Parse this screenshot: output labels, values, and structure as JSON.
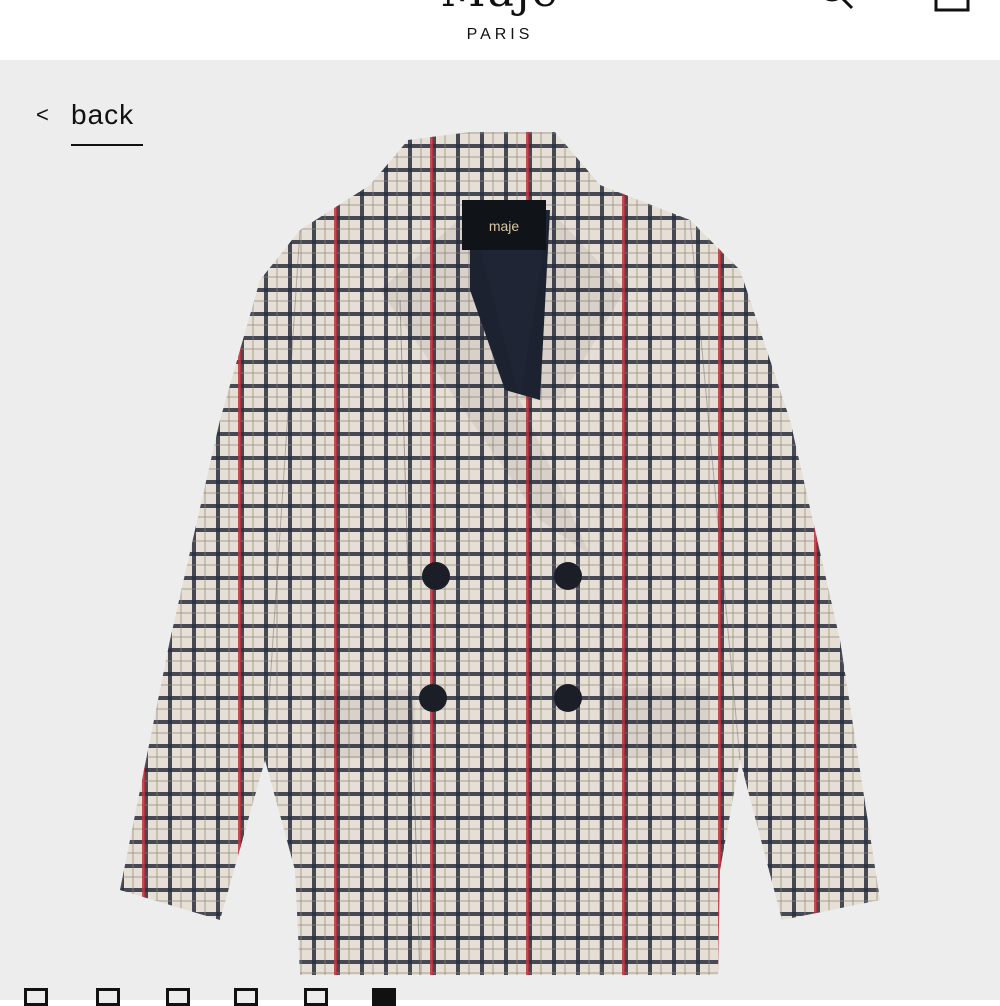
{
  "header": {
    "logo_text": "Maje",
    "tagline": "PARIS"
  },
  "nav": {
    "back_chevron": "<",
    "back_label": "back"
  },
  "product": {
    "image_label": "maje",
    "image_description_icon": "checked-double-breasted-blazer"
  },
  "gallery": {
    "slide_count": 6,
    "active_index": 5
  },
  "colors": {
    "background": "#ededed",
    "accent": "#111111",
    "check_red": "#c0303c",
    "check_navy": "#1f2535"
  }
}
